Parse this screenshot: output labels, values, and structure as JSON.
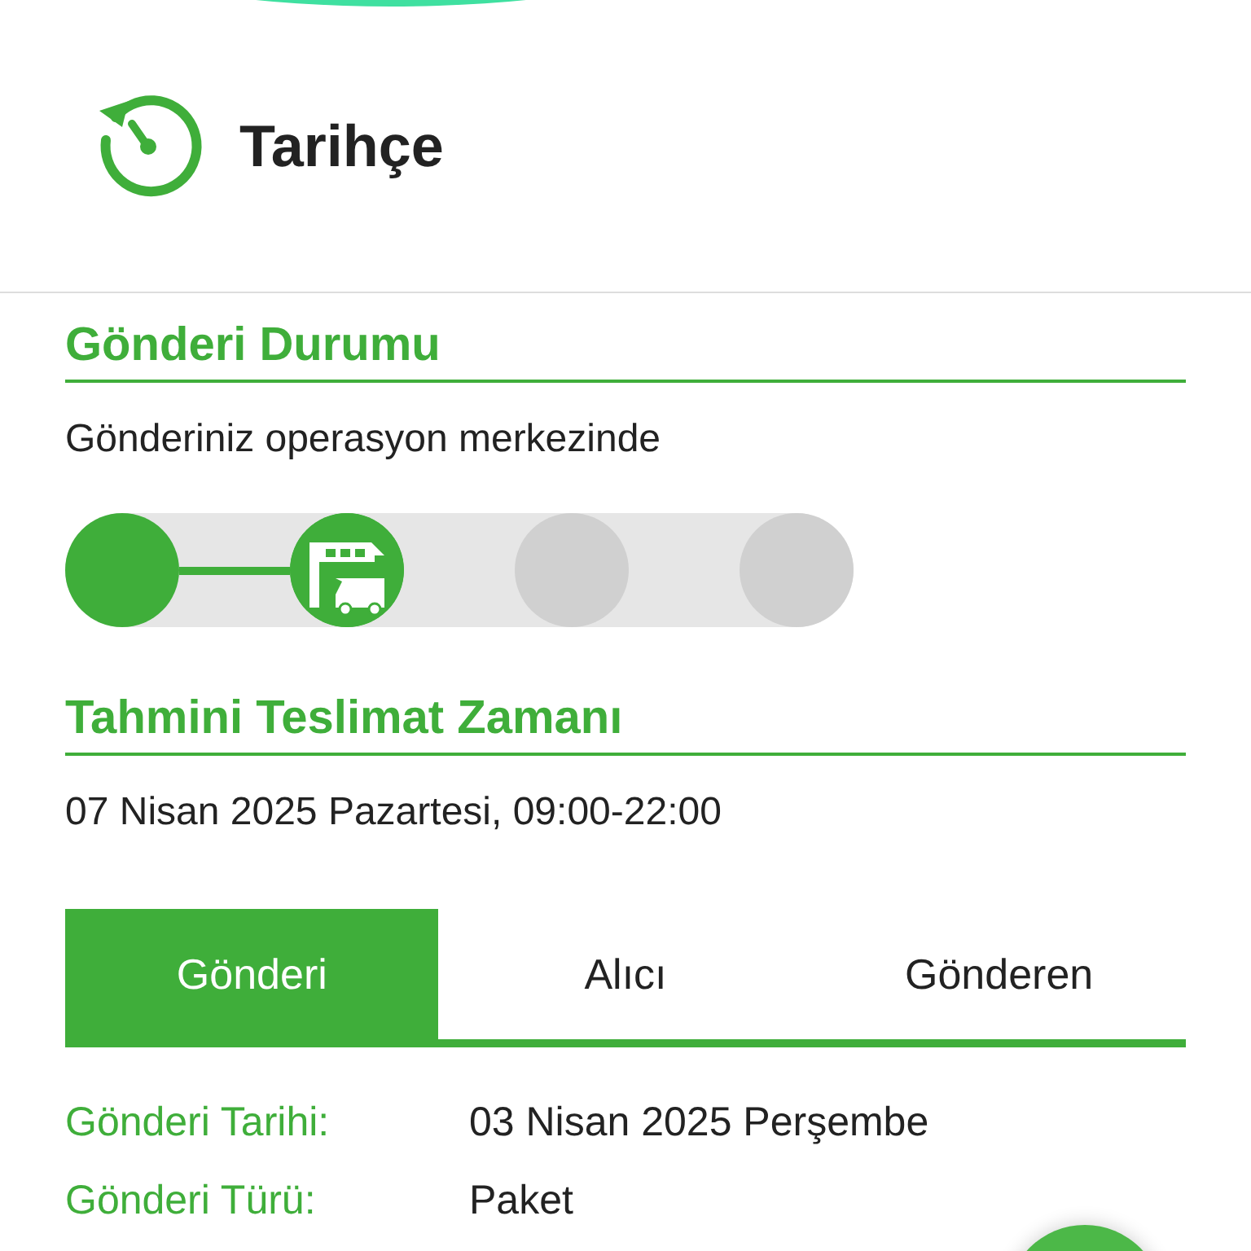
{
  "header": {
    "title": "Tarihçe"
  },
  "status": {
    "heading": "Gönderi Durumu",
    "message": "Gönderiniz operasyon merkezinde",
    "steps": [
      {
        "kind": "done"
      },
      {
        "kind": "current"
      },
      {
        "kind": "pending"
      },
      {
        "kind": "pending"
      }
    ]
  },
  "delivery": {
    "heading": "Tahmini Teslimat Zamanı",
    "time": "07 Nisan 2025 Pazartesi, 09:00-22:00"
  },
  "tabs": [
    {
      "label": "Gönderi",
      "selected": true
    },
    {
      "label": "Alıcı",
      "selected": false
    },
    {
      "label": "Gönderen",
      "selected": false
    }
  ],
  "details": [
    {
      "label": "Gönderi Tarihi:",
      "value": "03 Nisan 2025 Perşembe"
    },
    {
      "label": "Gönderi Türü:",
      "value": "Paket"
    }
  ]
}
